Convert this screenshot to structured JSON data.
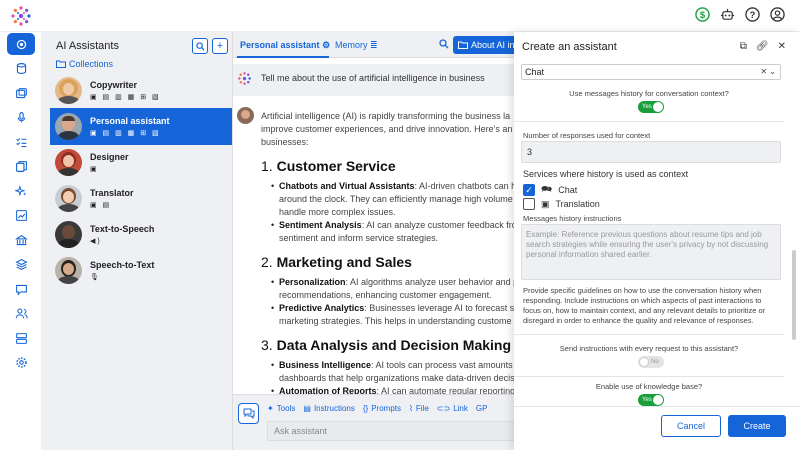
{
  "colors": {
    "accent": "#1565d8",
    "toggle_on": "#1a9e3c",
    "panel_bg": "#eef0f3"
  },
  "topbar": {
    "icons": [
      "dollar-icon",
      "robot-icon",
      "help-icon",
      "user-icon"
    ]
  },
  "rail": {
    "items": [
      "brain-icon",
      "database-icon",
      "images-icon",
      "microphone-icon",
      "checklist-icon",
      "copy-icon",
      "sparkles-icon",
      "chart-icon",
      "bank-icon",
      "layers-icon",
      "chat-icon",
      "users-icon",
      "server-icon",
      "gear-icon"
    ]
  },
  "assistants": {
    "title": "AI Assistants",
    "search_icon": "search-icon",
    "add_label": "+",
    "collections_label": "Collections",
    "items": [
      {
        "name": "Copywriter",
        "icons": "▣ ▤ ▥ ▦ ⊞ ▧"
      },
      {
        "name": "Personal assistant",
        "icons": "▣ ▤ ▥ ▦ ⊞ ▧"
      },
      {
        "name": "Designer",
        "icons": "▣"
      },
      {
        "name": "Translator",
        "icons": "▣ ▤"
      },
      {
        "name": "Text-to-Speech",
        "icons": "◀)"
      },
      {
        "name": "Speech-to-Text",
        "icons": "🎙"
      }
    ]
  },
  "chat": {
    "tab_active": "Personal assistant",
    "tab_memory": "Memory",
    "about_label": "About AI in",
    "user_message": "Tell me about the use of artificial intelligence in business",
    "intro_1": "Artificial intelligence (AI) is rapidly transforming the business la",
    "intro_2": "improve customer experiences, and drive innovation. Here's an",
    "intro_3": "businesses:",
    "s1_num": "1. ",
    "s1_title": "Customer Service",
    "s1_b1_bold": "Chatbots and Virtual Assistants",
    "s1_b1_rest": ": AI-driven chatbots can ha",
    "s1_b1_l2": "around the clock. They can efficiently manage high volume",
    "s1_b1_l3": "handle more complex issues.",
    "s1_b2_bold": "Sentiment Analysis",
    "s1_b2_rest": ": AI can analyze customer feedback fro",
    "s1_b2_l2": "sentiment and inform service strategies.",
    "s2_num": "2. ",
    "s2_title": "Marketing and Sales",
    "s2_b1_bold": "Personalization",
    "s2_b1_rest": ": AI algorithms analyze user behavior and p",
    "s2_b1_l2": "recommendations, enhancing customer engagement.",
    "s2_b2_bold": "Predictive Analytics",
    "s2_b2_rest": ": Businesses leverage AI to forecast sale",
    "s2_b2_l2": "marketing strategies. This helps in understanding custome",
    "s3_num": "3. ",
    "s3_title": "Data Analysis and Decision Making",
    "s3_b1_bold": "Business Intelligence",
    "s3_b1_rest": ": AI tools can process vast amounts o",
    "s3_b1_l2": "dashboards that help organizations make data-driven decis",
    "s3_b2_bold": "Automation of Reports",
    "s3_b2_rest": ": AI can automate regular reporting",
    "toolbar": {
      "tools": "Tools",
      "instructions": "Instructions",
      "prompts": "Prompts",
      "file": "File",
      "link": "Link",
      "gpt": "GP"
    },
    "input_placeholder": "Ask assistant"
  },
  "modal": {
    "title": "Create an assistant",
    "selected_value": "Chat",
    "history_label": "Use messages history for conversation context?",
    "history_toggle": "Yes",
    "responses_label": "Number of responses used for context",
    "responses_value": "3",
    "services_label": "Services where history is used as context",
    "service_chat": "Chat",
    "service_translation": "Translation",
    "instructions_label": "Messages history instructions",
    "instructions_placeholder": "Example: Reference previous questions about resume tips and job search strategies while ensuring the user's privacy by not discussing personal information shared earlier.",
    "help_text": "Provide specific guidelines on how to use the conversation history when responding. Include instructions on which aspects of past interactions to focus on, how to maintain context, and any relevant details to prioritize or disregard in order to enhance the quality and relevance of responses.",
    "send_label": "Send instructions with every request to this assistant?",
    "send_toggle": "No",
    "kb_label": "Enable use of knowledge base?",
    "kb_toggle": "Yes",
    "cancel": "Cancel",
    "create": "Create"
  }
}
